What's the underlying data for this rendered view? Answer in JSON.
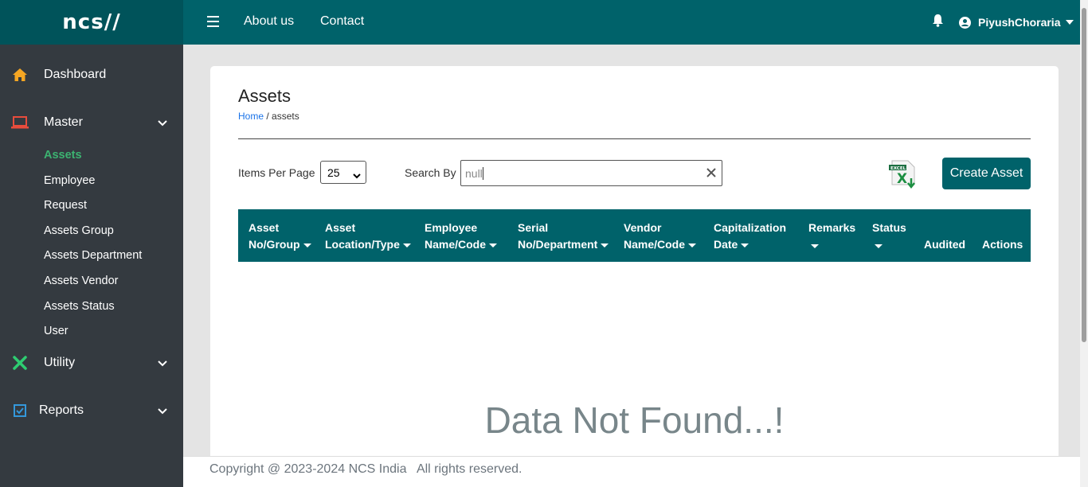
{
  "logo": {
    "text": "ncs//"
  },
  "sidebar": {
    "items": [
      {
        "label": "Dashboard",
        "icon": "home-icon",
        "color": "#f5a623"
      },
      {
        "label": "Master",
        "icon": "laptop-icon",
        "color": "#e74c3c"
      },
      {
        "label": "Utility",
        "icon": "tools-icon",
        "color": "#2ecc71"
      },
      {
        "label": "Reports",
        "icon": "checkbox-icon",
        "color": "#3498db"
      }
    ],
    "master_sub": [
      "Assets",
      "Employee",
      "Request",
      "Assets Group",
      "Assets Department",
      "Assets Vendor",
      "Assets Status",
      "User"
    ]
  },
  "topbar": {
    "links": [
      "About us",
      "Contact"
    ],
    "user_name": "PiyushChoraria"
  },
  "page": {
    "title": "Assets",
    "breadcrumb_home": "Home",
    "breadcrumb_sep": " / ",
    "breadcrumb_current": "assets"
  },
  "controls": {
    "items_per_page_label": "Items Per Page",
    "items_per_page_value": "25",
    "search_label": "Search By",
    "search_value": "null",
    "create_button": "Create Asset",
    "export_icon": "excel-export-icon"
  },
  "table": {
    "columns": [
      {
        "l1": "Asset",
        "l2": "No/Group",
        "sortable": true
      },
      {
        "l1": "Asset",
        "l2": "Location/Type",
        "sortable": true
      },
      {
        "l1": "Employee",
        "l2": "Name/Code",
        "sortable": true
      },
      {
        "l1": "Serial",
        "l2": "No/Department",
        "sortable": true
      },
      {
        "l1": "Vendor",
        "l2": "Name/Code",
        "sortable": true
      },
      {
        "l1": "Capitalization",
        "l2": "Date",
        "sortable": true
      },
      {
        "l1": "Remarks",
        "l2": "",
        "sortable": true
      },
      {
        "l1": "Status",
        "l2": "",
        "sortable": true
      },
      {
        "l1": "",
        "l2": "Audited",
        "sortable": false
      },
      {
        "l1": "",
        "l2": "Actions",
        "sortable": false
      }
    ],
    "empty_message": "Data Not Found...!"
  },
  "footer": {
    "text": "Copyright @ 2023-2024 NCS India   All rights reserved."
  },
  "colors": {
    "primary": "#00626a",
    "sidebar": "#343a40",
    "active": "#3cb371"
  }
}
